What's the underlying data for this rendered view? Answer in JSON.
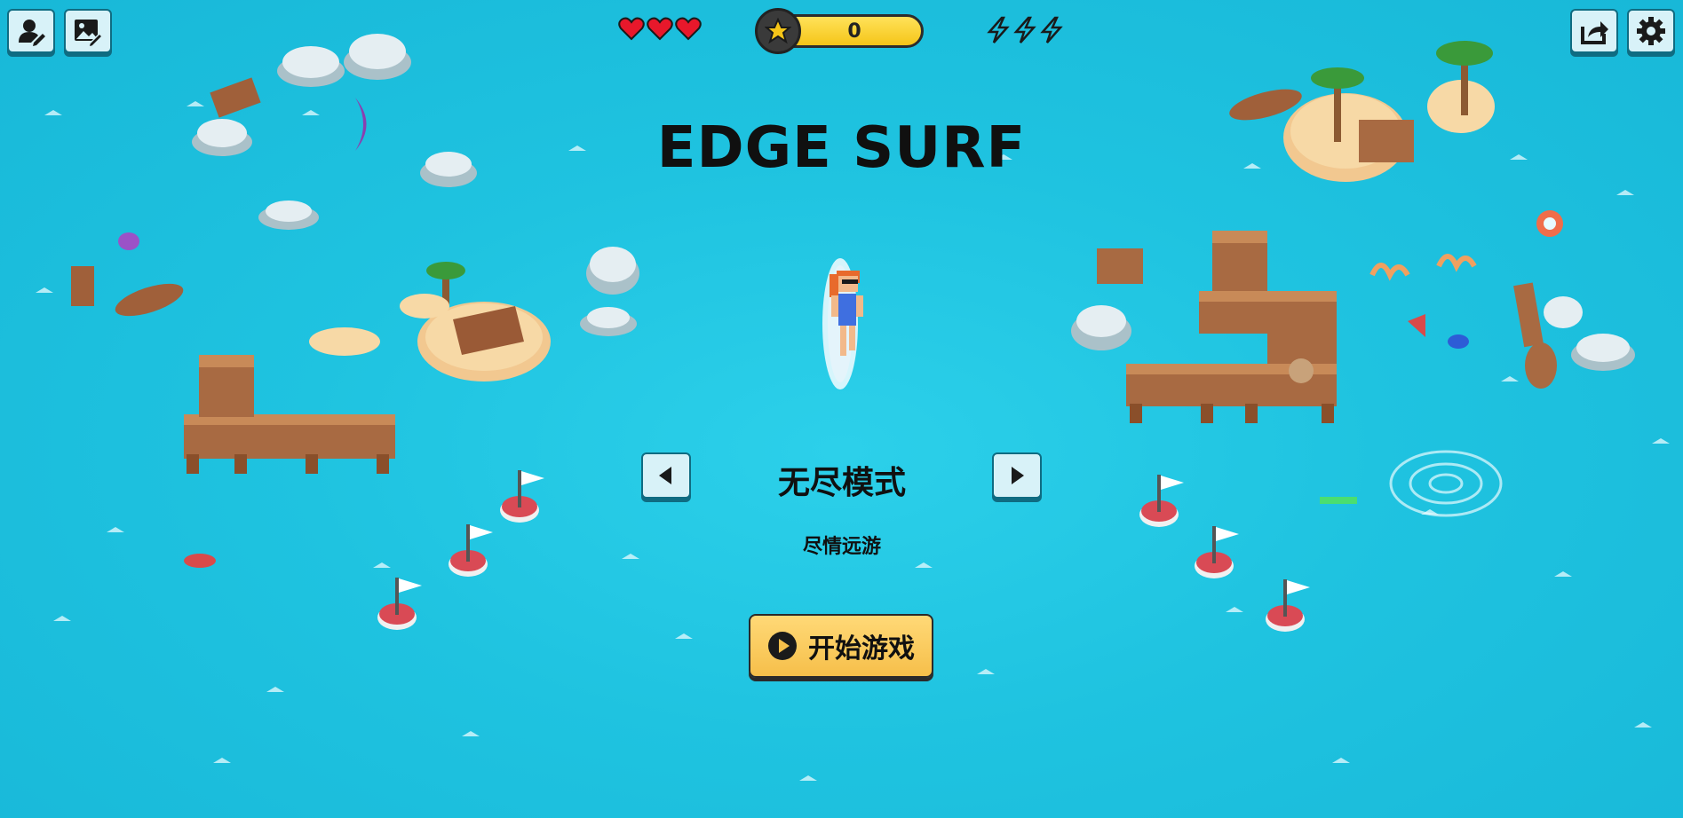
{
  "hud": {
    "hearts": 3,
    "score": "0",
    "energy_bolts": 3
  },
  "game": {
    "title": "EDGE SURF",
    "mode": {
      "name": "无尽模式",
      "description": "尽情远游"
    },
    "start_label": "开始游戏"
  },
  "icons": {
    "top_left": [
      "profile-edit-icon",
      "image-edit-icon"
    ],
    "top_right": [
      "share-icon",
      "gear-icon"
    ],
    "mode_nav": [
      "caret-left-icon",
      "caret-right-icon"
    ],
    "start": "play-icon"
  },
  "colors": {
    "sea": "#1fc3e0",
    "button_face": "#d8f2f8",
    "button_border": "#0f6c82",
    "start_button": "#f6bf4a",
    "score_pill": "#f5c518",
    "heart": "#e8182b"
  }
}
